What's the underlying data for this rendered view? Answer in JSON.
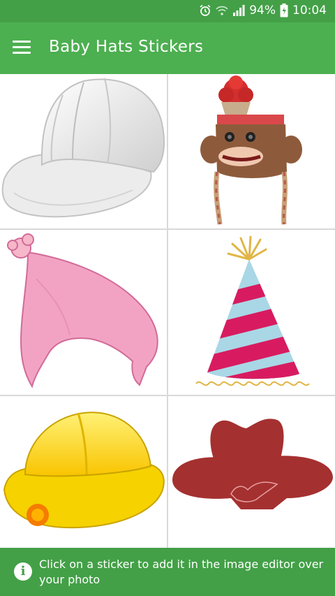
{
  "status_bar": {
    "battery": "94%",
    "time": "10:04",
    "icons": [
      "alarm-icon",
      "wifi-icon",
      "signal-icon",
      "battery-charging-icon"
    ]
  },
  "app_bar": {
    "menu_icon": "hamburger-menu-icon",
    "title": "Baby Hats Stickers"
  },
  "stickers": [
    {
      "name": "white-baseball-cap"
    },
    {
      "name": "sock-monkey-pompom-hat"
    },
    {
      "name": "pink-knit-hat"
    },
    {
      "name": "striped-party-hat"
    },
    {
      "name": "yellow-firefighter-helmet"
    },
    {
      "name": "red-cowboy-hat"
    }
  ],
  "info_bar": {
    "icon": "info-icon",
    "text": "Click on a sticker to add it in the image editor over your photo"
  },
  "colors": {
    "status_bar": "#43a047",
    "app_bar": "#4caf50",
    "info_bar": "#43a047"
  }
}
